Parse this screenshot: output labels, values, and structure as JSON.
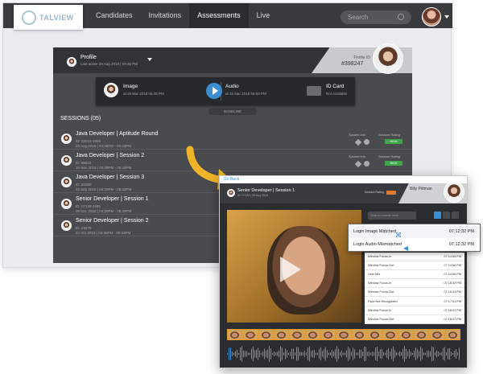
{
  "nav": {
    "brand": "TALVIEW",
    "tabs": [
      "Candidates",
      "Invitations",
      "Assessments",
      "Live"
    ],
    "active": "Assessments",
    "search_placeholder": "Search"
  },
  "profile": {
    "title": "Profile",
    "last_active": "Last active 29 Aug 2018 | 03:36 PM",
    "id_label": "Profile ID",
    "id_value": "#398247"
  },
  "media": {
    "image_label": "Image",
    "image_date": "at 25 Mar 2018 06:45 PM",
    "audio_label": "Audio",
    "audio_date": "at 25 Mar 2018 06:50 PM",
    "id_label": "ID Card",
    "id_status": "Not Available",
    "baseline": "BASELINE"
  },
  "sessions": {
    "title": "SESSIONS (05)",
    "system_info": "System Info",
    "session_rating": "Session Rating",
    "items": [
      {
        "title": "Java Developer | Aptitude Round",
        "id": "ID: 33241-1896",
        "date": "29 Aug 2018 | 03:36PM - 05:43PM",
        "rating": "HIGH"
      },
      {
        "title": "Java Developer | Session 2",
        "id": "ID: 88642",
        "date": "15 Nov 2018 | 04:39PM - 05:43PM",
        "rating": "HIGH"
      },
      {
        "title": "Java Developer | Session 3",
        "id": "ID: 82360",
        "date": "15 Sep 2018 | 04:39PM - 05:43PM",
        "rating": ""
      },
      {
        "title": "Senior Developer | Session 1",
        "id": "ID: 07129 2485",
        "date": "08 Dec 2018 | 04:39PM - 05:43PM",
        "rating": ""
      },
      {
        "title": "Senior Developer | Session 2",
        "id": "ID: 23275",
        "date": "24 Oct 2018 | 04:39PM - 05:43PM",
        "rating": ""
      }
    ]
  },
  "detail": {
    "back": "Go Back",
    "title": "Senior Developer | Session 1",
    "subtitle": "ID: 07129 | 25 Aug 2018",
    "candidate": "Billy Pittman",
    "session_rating": "Session Rating",
    "search_placeholder": "Search events here",
    "events": [
      {
        "name": "Window Focus-In",
        "time": "07:14:55 PM"
      },
      {
        "name": "Window Focus-Out",
        "time": "07:14:56 PM"
      },
      {
        "name": "User Idle",
        "time": "07:14:56 PM"
      },
      {
        "name": "Window Focus-In",
        "time": "07:16:32 PM"
      },
      {
        "name": "Window Focus-Out",
        "time": "07:16:41 PM"
      },
      {
        "name": "Face Not Recognized",
        "time": "07:17:51 PM"
      },
      {
        "name": "Window Focus-In",
        "time": "07:18:01 PM"
      },
      {
        "name": "Window Focus-Out",
        "time": "07:18:07 PM"
      }
    ]
  },
  "callout": {
    "row1": "Login Image Matched",
    "time1": "07:12:32 PM",
    "row2": "Login Audio Mismatched",
    "time2": "07:12:32 PM"
  },
  "colors": {
    "accent": "#3a8fd2",
    "rating_high": "#3fa74a",
    "arrow": "#f0b429",
    "topbar": "#3a3b3f"
  }
}
